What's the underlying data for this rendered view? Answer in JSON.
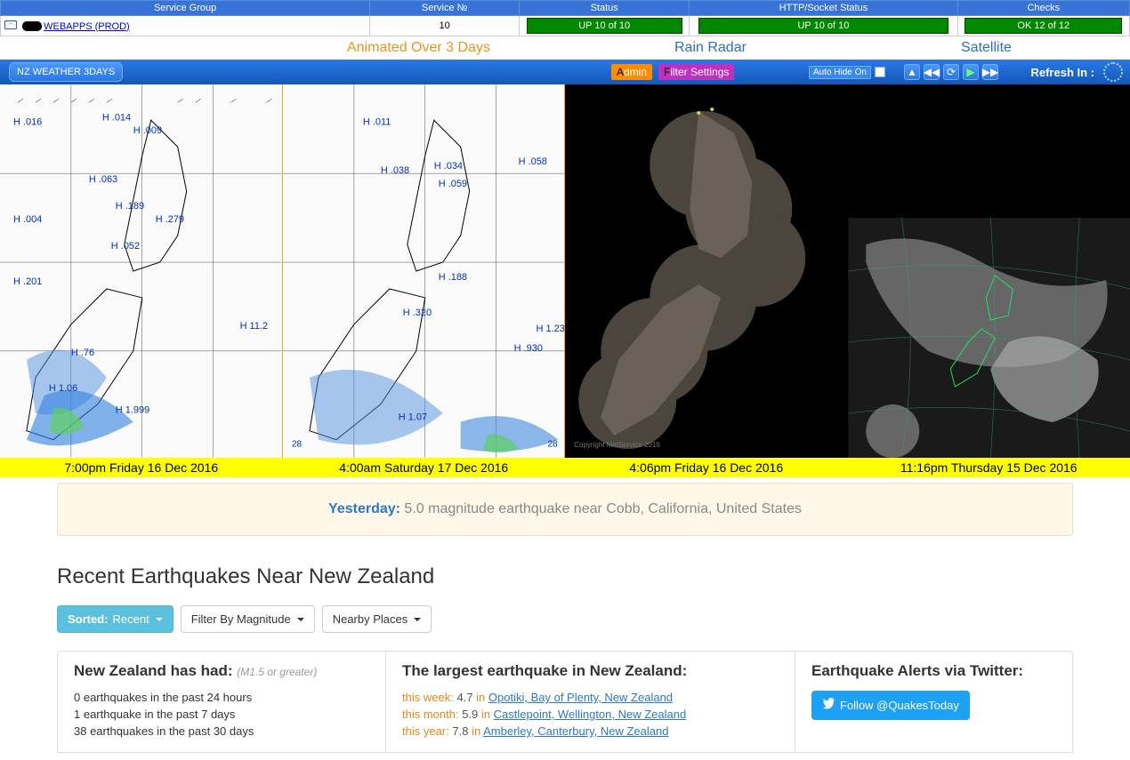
{
  "status_table": {
    "headers": [
      "Service Group",
      "Service №",
      "Status",
      "HTTP/Socket Status",
      "Checks"
    ],
    "row": {
      "group_link": "WEBAPPS (PROD)",
      "service_no": "10",
      "status": "UP 10 of 10",
      "http": "UP 10 of 10",
      "checks": "OK 12 of 12"
    }
  },
  "widget_titles": {
    "rain_radar": "Rain Radar",
    "satellite": "Satellite",
    "animated": "Animated Over 3 Days"
  },
  "control_bar": {
    "tab": "NZ WEATHER 3DAYS",
    "admin": "Admin",
    "filter": "Filter Settings",
    "autohide": "Auto Hide On",
    "refresh": "Refresh In :"
  },
  "maps": {
    "captions": [
      "7:00pm Friday 16 Dec 2016",
      "4:00am Saturday 17 Dec 2016",
      "4:06pm Friday 16 Dec 2016",
      "11:16pm Thursday 15 Dec 2016"
    ],
    "radar_copyright": "Copyright MetService 2016"
  },
  "yesterday": {
    "label": "Yesterday:",
    "text": " 5.0 magnitude earthquake near Cobb, California, United States"
  },
  "recent": {
    "heading": "Recent Earthquakes Near New Zealand",
    "sort_label": "Sorted:",
    "sort_val": "Recent",
    "filter_mag": "Filter By Magnitude",
    "nearby": "Nearby Places",
    "nz_head": "New Zealand has had:",
    "nz_sub": "(M1.5 or greater)",
    "stats": [
      "0 earthquakes in the past 24 hours",
      "1 earthquake in the past 7 days",
      "38 earthquakes in the past 30 days"
    ],
    "largest_head": "The largest earthquake in New Zealand:",
    "largest": [
      {
        "period": "this week:",
        "mag": "4.7",
        "in": "in",
        "loc": "Opotiki, Bay of Plenty, New Zealand"
      },
      {
        "period": "this month:",
        "mag": "5.9",
        "in": "in",
        "loc": "Castlepoint, Wellington, New Zealand"
      },
      {
        "period": "this year:",
        "mag": "7.8",
        "in": "in",
        "loc": "Amberley, Canterbury, New Zealand"
      }
    ],
    "twitter_head": "Earthquake Alerts via Twitter:",
    "twitter_btn": "Follow @QuakesToday"
  }
}
